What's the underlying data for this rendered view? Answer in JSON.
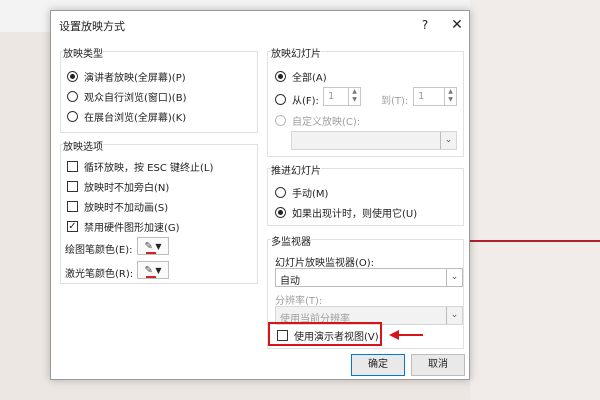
{
  "dialog": {
    "title": "设置放映方式",
    "help": "?",
    "close": "✕"
  },
  "show_type": {
    "title": "放映类型",
    "options": [
      "演讲者放映(全屏幕)(P)",
      "观众自行浏览(窗口)(B)",
      "在展台浏览(全屏幕)(K)"
    ],
    "selected": 0
  },
  "show_options": {
    "title": "放映选项",
    "items": [
      {
        "label": "循环放映，按 ESC 键终止(L)",
        "checked": false
      },
      {
        "label": "放映时不加旁白(N)",
        "checked": false
      },
      {
        "label": "放映时不加动画(S)",
        "checked": false
      },
      {
        "label": "禁用硬件图形加速(G)",
        "checked": true
      }
    ],
    "pen_color_label": "绘图笔颜色(E):",
    "laser_color_label": "激光笔颜色(R):",
    "pen_color": "#d71f26",
    "laser_color": "#d71f26"
  },
  "slides": {
    "title": "放映幻灯片",
    "all_label": "全部(A)",
    "from_label": "从(F):",
    "from_value": "1",
    "to_label": "到(T):",
    "to_value": "1",
    "custom_label": "自定义放映(C):",
    "custom_value": ""
  },
  "advance": {
    "title": "推进幻灯片",
    "manual_label": "手动(M)",
    "timing_label": "如果出现计时，则使用它(U)"
  },
  "monitors": {
    "title": "多监视器",
    "monitor_label": "幻灯片放映监视器(O):",
    "monitor_value": "自动",
    "resolution_label": "分辨率(T):",
    "resolution_value": "使用当前分辨率",
    "presenter_view_label": "使用演示者视图(V)",
    "presenter_view_checked": false
  },
  "buttons": {
    "ok": "确定",
    "cancel": "取消"
  },
  "colors": {
    "highlight": "#d8131c",
    "accent": "#0078d7"
  }
}
